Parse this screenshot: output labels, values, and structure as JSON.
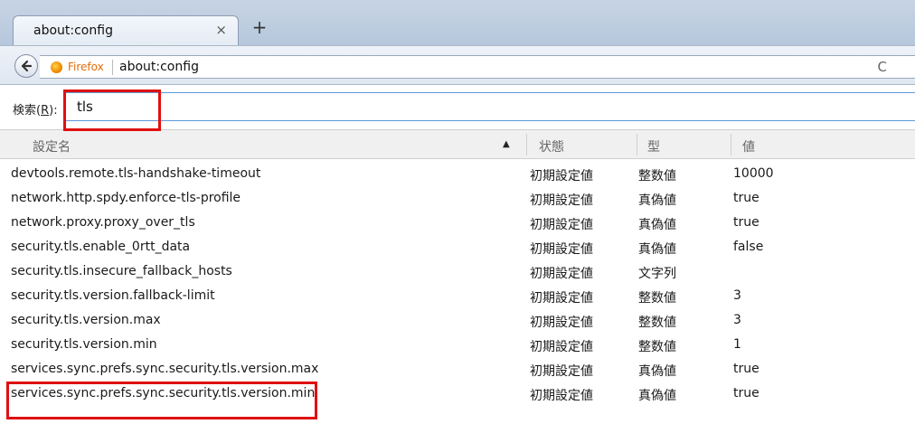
{
  "tab": {
    "title": "about:config",
    "close": "×",
    "new_tab": "+"
  },
  "navbar": {
    "back_icon": "arrow-left",
    "identity_label": "Firefox",
    "url": "about:config",
    "reload_icon": "C"
  },
  "search": {
    "label_prefix": "検索(",
    "label_accel": "R",
    "label_suffix": "):",
    "value": "tls"
  },
  "table": {
    "headers": {
      "name": "設定名",
      "status": "状態",
      "type": "型",
      "value": "値"
    },
    "sort_indicator": "▲",
    "rows": [
      {
        "name": "devtools.remote.tls-handshake-timeout",
        "status": "初期設定値",
        "type": "整数値",
        "value": "10000"
      },
      {
        "name": "network.http.spdy.enforce-tls-profile",
        "status": "初期設定値",
        "type": "真偽値",
        "value": "true"
      },
      {
        "name": "network.proxy.proxy_over_tls",
        "status": "初期設定値",
        "type": "真偽値",
        "value": "true"
      },
      {
        "name": "security.tls.enable_0rtt_data",
        "status": "初期設定値",
        "type": "真偽値",
        "value": "false"
      },
      {
        "name": "security.tls.insecure_fallback_hosts",
        "status": "初期設定値",
        "type": "文字列",
        "value": ""
      },
      {
        "name": "security.tls.version.fallback-limit",
        "status": "初期設定値",
        "type": "整数値",
        "value": "3"
      },
      {
        "name": "security.tls.version.max",
        "status": "初期設定値",
        "type": "整数値",
        "value": "3"
      },
      {
        "name": "security.tls.version.min",
        "status": "初期設定値",
        "type": "整数値",
        "value": "1"
      },
      {
        "name": "services.sync.prefs.sync.security.tls.version.max",
        "status": "初期設定値",
        "type": "真偽値",
        "value": "true"
      },
      {
        "name": "services.sync.prefs.sync.security.tls.version.min",
        "status": "初期設定値",
        "type": "真偽値",
        "value": "true"
      }
    ]
  },
  "annotations": {
    "highlight_color": "#e01010"
  }
}
